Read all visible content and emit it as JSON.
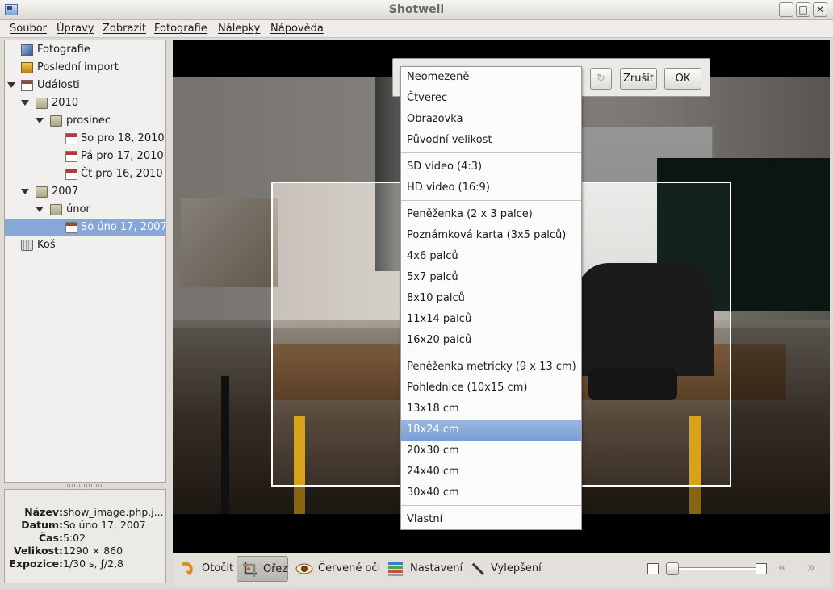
{
  "window": {
    "title": "Shotwell"
  },
  "menu": [
    {
      "label": "Soubor"
    },
    {
      "label": "Úpravy"
    },
    {
      "label": "Zobrazit"
    },
    {
      "label": "Fotografie"
    },
    {
      "label": "Nálepky"
    },
    {
      "label": "Nápověda"
    }
  ],
  "sidebar": {
    "photos": "Fotografie",
    "last_import": "Poslední import",
    "events": "Události",
    "y2010": "2010",
    "prosinec": "prosinec",
    "d1": "So pro 18, 2010",
    "d2": "Pá pro 17, 2010",
    "d3": "Čt pro 16, 2010",
    "y2007": "2007",
    "unor": "únor",
    "d4": "So úno 17, 2007",
    "trash": "Koš"
  },
  "properties": {
    "name_key": "Název:",
    "name_val": "show_image.php.j...",
    "date_key": "Datum:",
    "date_val": "So úno 17, 2007",
    "time_key": "Čas:",
    "time_val": "5:02",
    "size_key": "Velikost:",
    "size_val": "1290 × 860",
    "exp_key": "Expozice:",
    "exp_val": "1/30 s, ƒ/2,8"
  },
  "crop_toolbar": {
    "cancel": "Zrušit",
    "ok": "OK"
  },
  "crop_options": [
    "Neomezeně",
    "Čtverec",
    "Obrazovka",
    "Původní velikost",
    "SD video (4:3)",
    "HD video (16:9)",
    "Peněženka (2 x 3 palce)",
    "Poznámková karta (3x5 palců)",
    "4x6 palců",
    "5x7 palců",
    "8x10 palců",
    "11x14 palců",
    "16x20 palců",
    "Peněženka metricky (9 x 13 cm)",
    "Pohlednice (10x15 cm)",
    "13x18 cm",
    "18x24 cm",
    "20x30 cm",
    "24x40 cm",
    "30x40 cm",
    "Vlastní"
  ],
  "crop_selected": "18x24 cm",
  "toolbar": {
    "rotate": "Otočit",
    "crop": "Ořez",
    "redeye": "Červené oči",
    "adjust": "Nastavení",
    "enhance": "Vylepšení"
  },
  "zoom": {
    "level": 0.05
  },
  "icons": {
    "rotate": "rotate-icon",
    "crop": "crop-icon",
    "redeye": "eye-icon",
    "adjust": "sliders-icon",
    "enhance": "magic-wand-icon",
    "back": "arrow-left-icon",
    "forward": "arrow-right-icon"
  }
}
